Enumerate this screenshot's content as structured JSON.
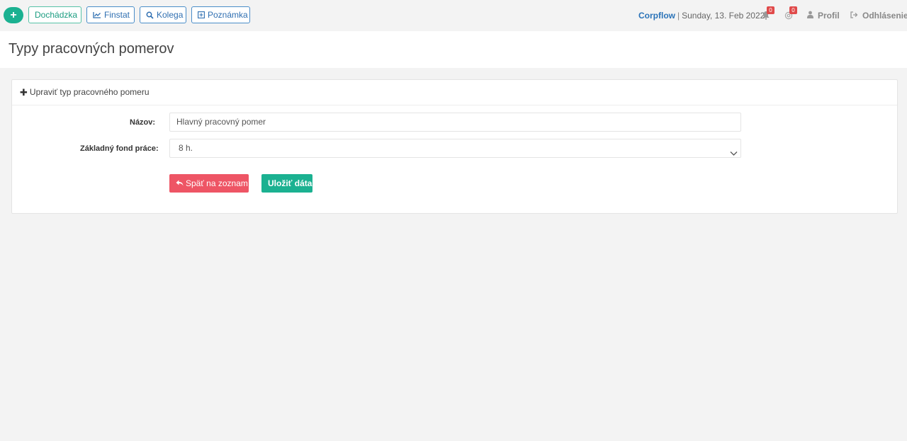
{
  "topbar": {
    "add_label": "+",
    "buttons": [
      {
        "label": "Dochádzka",
        "icon": "none"
      },
      {
        "label": "Finstat",
        "icon": "line-chart-icon"
      },
      {
        "label": "Kolega",
        "icon": "search-icon"
      },
      {
        "label": "Poznámka",
        "icon": "plus-square-icon"
      }
    ],
    "brand": "Corpflow",
    "separator": "|",
    "date": "Sunday, 13. Feb 2022",
    "notifications_count": "0",
    "mentions_count": "0",
    "profile_label": "Profil",
    "logout_label": "Odhlásenie"
  },
  "page": {
    "title": "Typy pracovných pomerov"
  },
  "panel": {
    "title": "Upraviť typ pracovného pomeru",
    "name_label": "Názov:",
    "name_value": "Hlavný pracovný pomer",
    "fund_label": "Základný fond práce:",
    "fund_value": "8 h.",
    "back_label": "Späť na zoznam",
    "save_label": "Uložiť dáta"
  },
  "colors": {
    "accent_green": "#1bb191",
    "accent_blue": "#2a73b8",
    "danger": "#ee5565",
    "badge": "#e04a4a"
  }
}
